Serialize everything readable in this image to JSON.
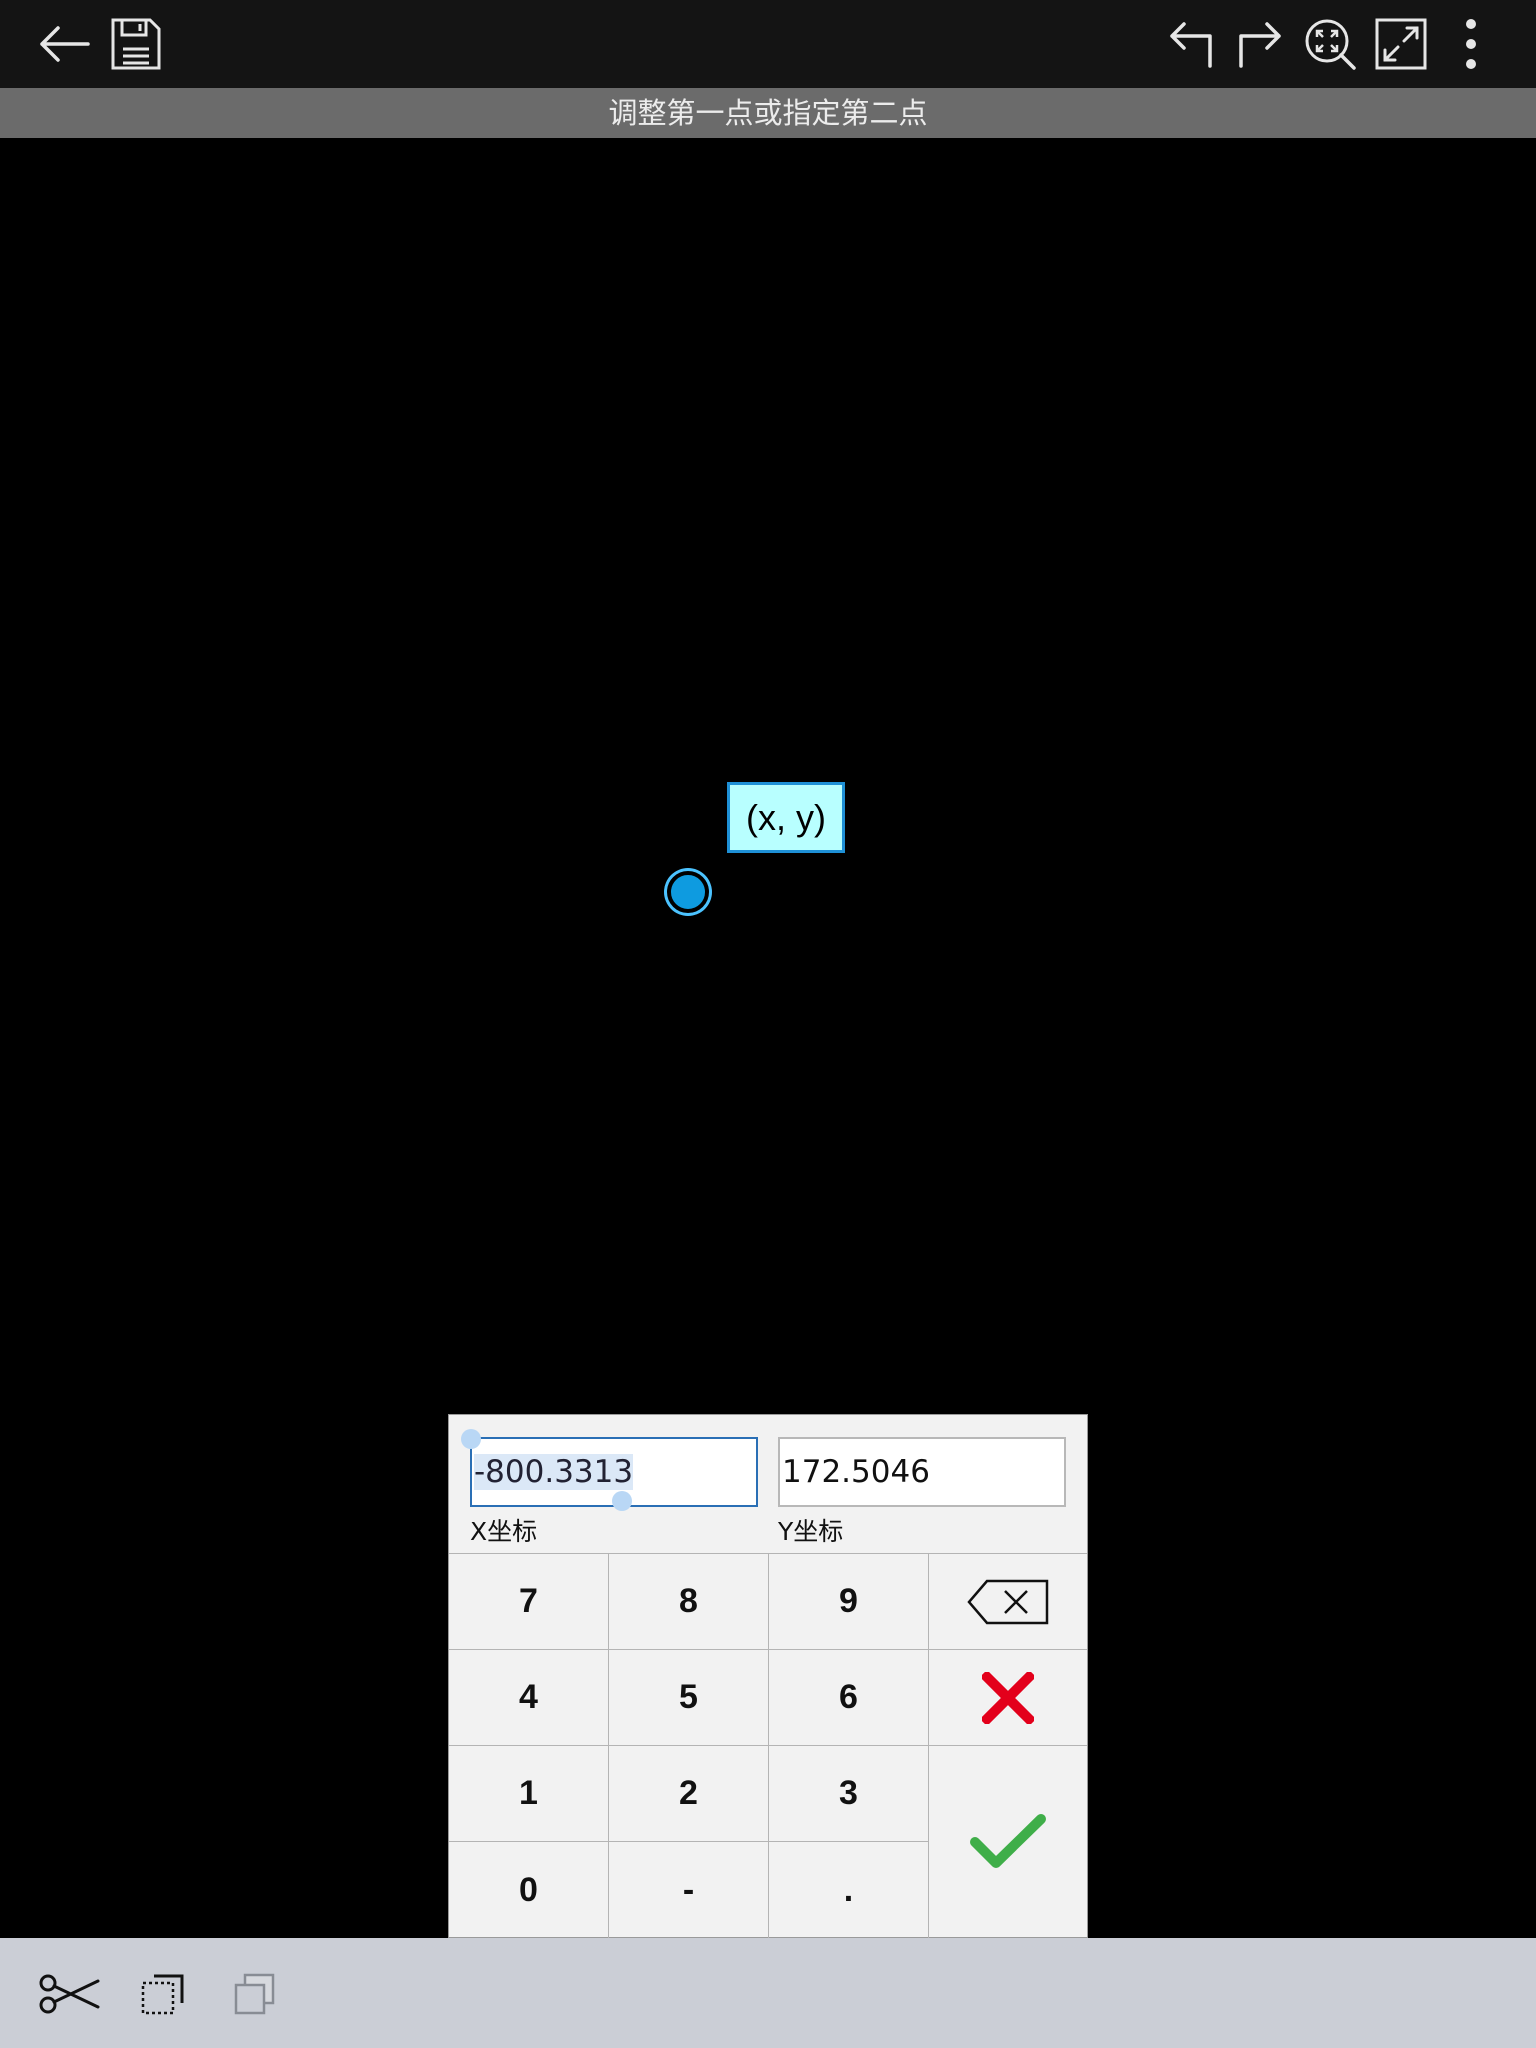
{
  "toolbar": {
    "back_icon": "arrow-left-icon",
    "save_icon": "floppy-disk-icon",
    "undo_icon": "undo-arrow-icon",
    "redo_icon": "redo-arrow-icon",
    "zoom_extents_icon": "zoom-extents-icon",
    "fullscreen_icon": "expand-icon",
    "more_icon": "more-vertical-icon"
  },
  "prompt": {
    "text": "调整第一点或指定第二点"
  },
  "canvas": {
    "tooltip": "(x, y)",
    "point_color": "#0e9be0"
  },
  "coord_input": {
    "x_value": "-800.3313",
    "y_value": "172.5046",
    "x_label": "X坐标",
    "y_label": "Y坐标"
  },
  "keypad": {
    "rows": [
      [
        "7",
        "8",
        "9"
      ],
      [
        "4",
        "5",
        "6"
      ],
      [
        "1",
        "2",
        "3"
      ],
      [
        "0",
        "-",
        "."
      ]
    ],
    "backspace_icon": "backspace-icon",
    "cancel_icon": "close-icon",
    "confirm_icon": "checkmark-icon",
    "cancel_color": "#e3001b",
    "confirm_color": "#3fae49"
  },
  "bottom_toolbar": {
    "cut_icon": "scissors-icon",
    "copy_icon": "copy-icon",
    "paste_icon": "paste-icon"
  }
}
